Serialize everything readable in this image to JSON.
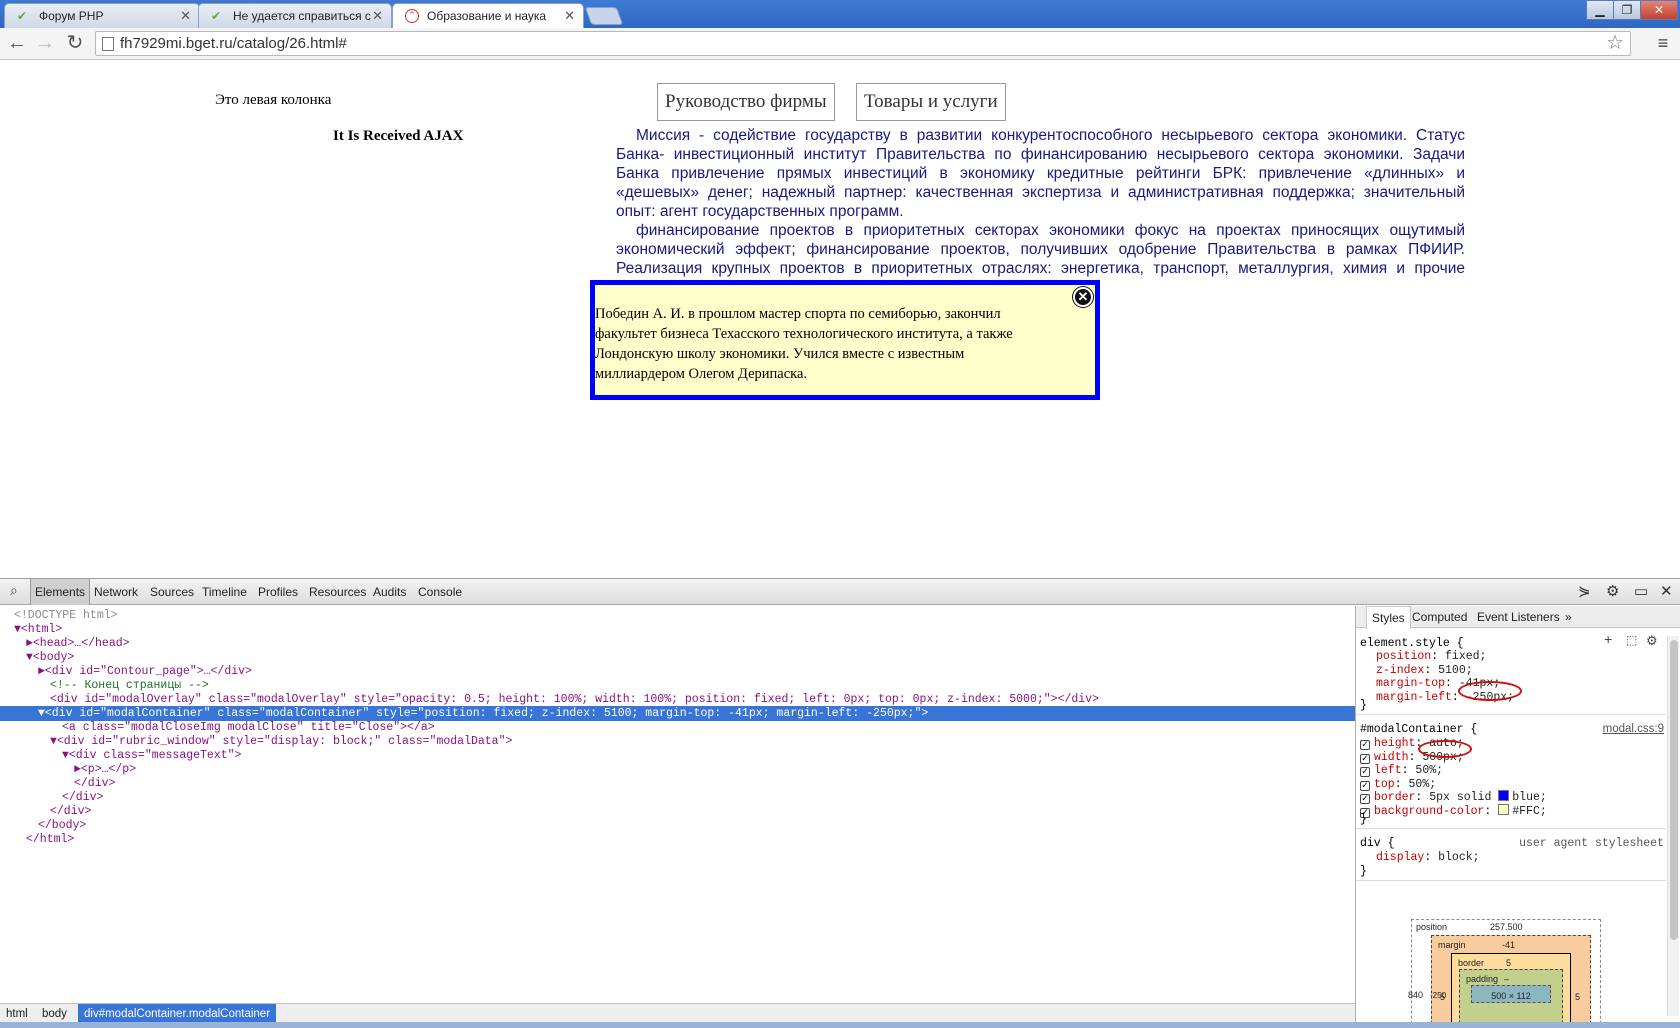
{
  "browser": {
    "tabs": [
      {
        "label": "Форум PHP",
        "active": false
      },
      {
        "label": "Не удается справиться с",
        "active": false
      },
      {
        "label": "Образование и наука",
        "active": true
      }
    ],
    "url": "fh7929mi.bget.ru/catalog/26.html#",
    "window_controls": [
      "minimize",
      "restore",
      "close"
    ]
  },
  "page": {
    "left_column": "Это левая колонка",
    "ajax_text": "It Is Received AJAX",
    "buttons": [
      "Руководство фирмы",
      "Товары и услуги"
    ],
    "paragraph1": "Миссия - содействие государству в развитии конкурентоспособного несырьевого сектора экономики. Статус Банка- инвестиционный институт Правительства по финансированию несырьевого сектора экономики. Задачи Банка привлечение прямых инвестиций в экономику кредитные рейтинги БРК: привлечение «длинных» и «дешевых» денег; надежный партнер: качественная экспертиза и административная поддержка; значительный опыт: агент государственных программ.",
    "paragraph2": "финансирование проектов в приоритетных секторах экономики фокус на проектах приносящих ощутимый экономический эффект; финансирование проектов, получивших одобрение Правительства в рамках ПФИИР. Реализация крупных проектов в приоритетных отраслях: энергетика, транспорт, металлургия, химия и прочие отрасли.",
    "modal": {
      "text": "Победин А. И. в прошлом мастер спорта по семиборью, закончил факультет бизнеса Техасского технологического института, а также Лондонскую школу экономики. Учился вместе с известным миллиардером Олегом Дерипаска.",
      "close_title": "Close",
      "border_color": "#0000ff",
      "background": "#ffffcc"
    }
  },
  "devtools": {
    "tabs": [
      "Elements",
      "Network",
      "Sources",
      "Timeline",
      "Profiles",
      "Resources",
      "Audits",
      "Console"
    ],
    "selected_tab": "Elements",
    "dom_lines": [
      {
        "indent": 0,
        "text": "<!DOCTYPE html>",
        "type": "doctype"
      },
      {
        "indent": 0,
        "text": "▼<html>",
        "type": "tag"
      },
      {
        "indent": 1,
        "text": "►<head>…</head>",
        "type": "tag"
      },
      {
        "indent": 1,
        "text": "▼<body>",
        "type": "tag"
      },
      {
        "indent": 2,
        "text": "►<div id=\"Contour_page\">…</div>",
        "type": "tag"
      },
      {
        "indent": 3,
        "text": "<!-- Конец страницы -->",
        "type": "comment"
      },
      {
        "indent": 3,
        "text": "<div id=\"modalOverlay\" class=\"modalOverlay\" style=\"opacity: 0.5; height: 100%; width: 100%; position: fixed; left: 0px; top: 0px; z-index: 5000;\"></div>",
        "type": "tag"
      },
      {
        "indent": 2,
        "text": "▼<div id=\"modalContainer\" class=\"modalContainer\" style=\"position: fixed; z-index: 5100; margin-top: -41px; margin-left: -250px;\">",
        "type": "selected"
      },
      {
        "indent": 4,
        "text": "<a class=\"modalCloseImg modalClose\" title=\"Close\"></a>",
        "type": "tag"
      },
      {
        "indent": 3,
        "text": "▼<div id=\"rubric_window\" style=\"display: block;\" class=\"modalData\">",
        "type": "tag"
      },
      {
        "indent": 4,
        "text": "▼<div class=\"messageText\">",
        "type": "tag"
      },
      {
        "indent": 5,
        "text": "►<p>…</p>",
        "type": "tag"
      },
      {
        "indent": 5,
        "text": "</div>",
        "type": "tag"
      },
      {
        "indent": 4,
        "text": "</div>",
        "type": "tag"
      },
      {
        "indent": 3,
        "text": "</div>",
        "type": "tag"
      },
      {
        "indent": 2,
        "text": "</body>",
        "type": "tag"
      },
      {
        "indent": 1,
        "text": "</html>",
        "type": "tag"
      }
    ],
    "breadcrumb": [
      "html",
      "body",
      "div#modalContainer.modalContainer"
    ],
    "sidebar_tabs": [
      "Styles",
      "Computed",
      "Event Listeners",
      "»"
    ],
    "styles": {
      "element_style_selector": "element.style {",
      "element_style_props": [
        {
          "name": "position",
          "value": "fixed;"
        },
        {
          "name": "z-index",
          "value": "5100;"
        },
        {
          "name": "margin-top",
          "value": "-41px;"
        },
        {
          "name": "margin-left",
          "value": "-250px;"
        }
      ],
      "rule2_selector": "#modalContainer {",
      "rule2_source": "modal.css:9",
      "rule2_props": [
        {
          "name": "height",
          "value": "auto;"
        },
        {
          "name": "width",
          "value": "500px;"
        },
        {
          "name": "left",
          "value": "50%;"
        },
        {
          "name": "top",
          "value": "50%;"
        },
        {
          "name": "border",
          "value": "5px solid",
          "swatch": "#0000ff",
          "after": "blue;"
        },
        {
          "name": "background-color",
          "value": "",
          "swatch": "#ffffcc",
          "after": "#FFC;"
        }
      ],
      "rule3_selector": "div {",
      "rule3_source": "user agent stylesheet",
      "rule3_props": [
        {
          "name": "display",
          "value": "block;"
        }
      ],
      "close_brace": "}"
    },
    "box_model": {
      "position_label": "position",
      "position_value": "257.500",
      "margin_label": "margin",
      "margin_top": "-41",
      "border_label": "border",
      "border_value": "5",
      "padding_label": "padding",
      "padding_value": "–",
      "content": "500 × 112",
      "left_pos": "840",
      "left_margin": "-250",
      "left_border": "5",
      "right_border": "5"
    }
  }
}
